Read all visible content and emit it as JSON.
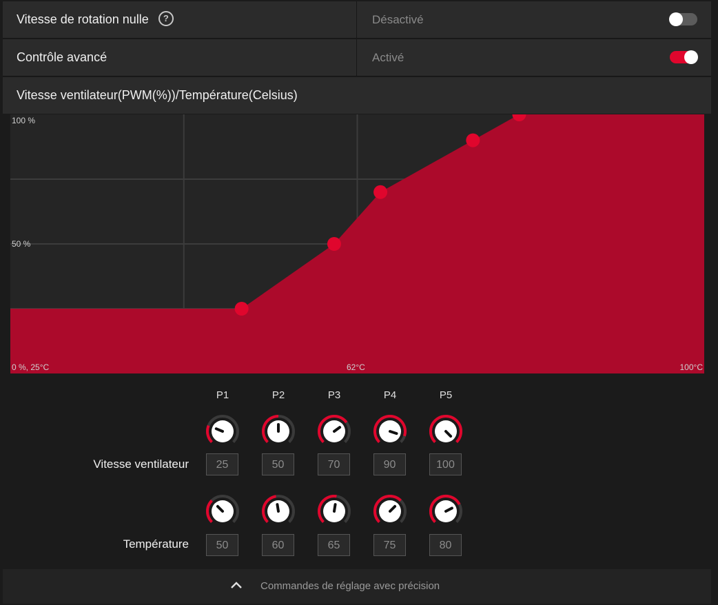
{
  "zero_rpm": {
    "label": "Vitesse de rotation nulle",
    "help_icon": "?",
    "status": "Désactivé",
    "enabled": false
  },
  "advanced": {
    "label": "Contrôle avancé",
    "status": "Activé",
    "enabled": true
  },
  "chart_title": "Vitesse ventilateur(PWM(%))/Température(Celsius)",
  "chart_data": {
    "type": "area",
    "title": "Vitesse ventilateur(PWM(%))/Température(Celsius)",
    "x_unit": "°C",
    "y_unit": "%",
    "xlim": [
      25,
      100
    ],
    "ylim": [
      0,
      100
    ],
    "points": [
      {
        "x": 50,
        "y": 25
      },
      {
        "x": 60,
        "y": 50
      },
      {
        "x": 65,
        "y": 70
      },
      {
        "x": 75,
        "y": 90
      },
      {
        "x": 80,
        "y": 100
      }
    ],
    "labels": {
      "origin": "0 %, 25°C",
      "y_mid": "50 %",
      "y_max": "100 %",
      "x_mid": "62°C",
      "x_max": "100°C"
    },
    "grid": true,
    "colors": {
      "fill": "#ac0a2b",
      "point": "#e0062d",
      "background": "#252525",
      "grid": "#3c3c3c"
    }
  },
  "points": [
    "P1",
    "P2",
    "P3",
    "P4",
    "P5"
  ],
  "fan_speed": {
    "label": "Vitesse ventilateur",
    "values": [
      "25",
      "50",
      "70",
      "90",
      "100"
    ]
  },
  "temperature": {
    "label": "Température",
    "values": [
      "50",
      "60",
      "65",
      "75",
      "80"
    ]
  },
  "footer": {
    "label": "Commandes de réglage avec précision",
    "icon": "chevron-up-icon"
  },
  "accent": "#e0062d"
}
